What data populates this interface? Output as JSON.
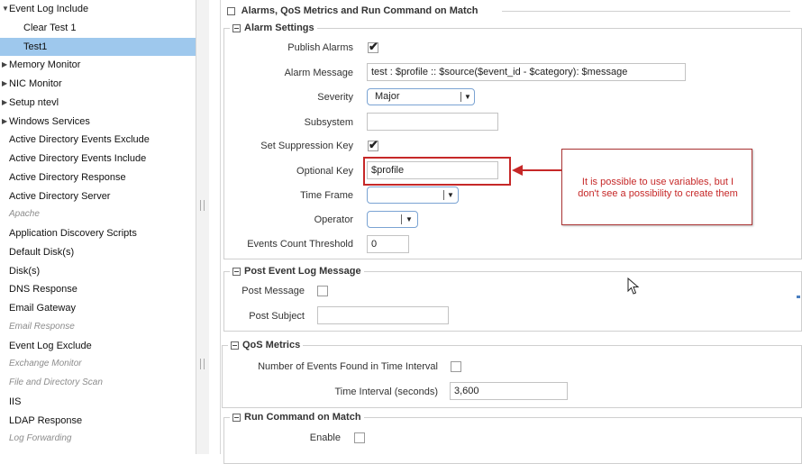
{
  "tree": {
    "items": [
      {
        "label": "Event Log Include",
        "arrow": "▼",
        "type": "expanded"
      },
      {
        "label": "Clear Test 1",
        "type": "child"
      },
      {
        "label": "Test1",
        "type": "child-selected"
      },
      {
        "label": "Memory Monitor",
        "arrow": "▶",
        "type": "collapsed"
      },
      {
        "label": "NIC Monitor",
        "arrow": "▶",
        "type": "collapsed"
      },
      {
        "label": "Setup ntevl",
        "arrow": "▶",
        "type": "collapsed"
      },
      {
        "label": "Windows Services",
        "arrow": "▶",
        "type": "collapsed"
      },
      {
        "label": "Active Directory Events Exclude",
        "type": "leaf"
      },
      {
        "label": "Active Directory Events Include",
        "type": "leaf"
      },
      {
        "label": "Active Directory Response",
        "type": "leaf"
      },
      {
        "label": "Active Directory Server",
        "type": "leaf"
      },
      {
        "label": "Apache",
        "type": "disabled"
      },
      {
        "label": "Application Discovery Scripts",
        "type": "leaf"
      },
      {
        "label": "Default Disk(s)",
        "type": "leaf"
      },
      {
        "label": "Disk(s)",
        "type": "leaf"
      },
      {
        "label": "DNS Response",
        "type": "leaf"
      },
      {
        "label": "Email Gateway",
        "type": "leaf"
      },
      {
        "label": "Email Response",
        "type": "disabled"
      },
      {
        "label": "Event Log Exclude",
        "type": "leaf"
      },
      {
        "label": "Exchange Monitor",
        "type": "disabled"
      },
      {
        "label": "File and Directory Scan",
        "type": "disabled"
      },
      {
        "label": "IIS",
        "type": "leaf"
      },
      {
        "label": "LDAP Response",
        "type": "leaf"
      },
      {
        "label": "Log Forwarding",
        "type": "disabled"
      }
    ]
  },
  "main": {
    "section_title": "Alarms, QoS Metrics and Run Command on Match",
    "alarm_settings": {
      "title": "Alarm Settings",
      "publish_alarms_label": "Publish Alarms",
      "publish_alarms_checked": true,
      "alarm_message_label": "Alarm Message",
      "alarm_message_value": "test :  $profile :: $source($event_id - $category): $message",
      "severity_label": "Severity",
      "severity_value": "Major",
      "subsystem_label": "Subsystem",
      "subsystem_value": "",
      "suppression_label": "Set Suppression Key",
      "suppression_checked": true,
      "optional_key_label": "Optional Key",
      "optional_key_value": "$profile",
      "time_frame_label": "Time Frame",
      "time_frame_value": "",
      "operator_label": "Operator",
      "operator_value": "",
      "events_threshold_label": "Events Count Threshold",
      "events_threshold_value": "0"
    },
    "post_event": {
      "title": "Post Event Log Message",
      "post_message_label": "Post Message",
      "post_message_checked": false,
      "post_subject_label": "Post Subject",
      "post_subject_value": ""
    },
    "qos": {
      "title": "QoS Metrics",
      "events_found_label": "Number of Events Found in Time Interval",
      "events_found_checked": false,
      "time_interval_label": "Time Interval (seconds)",
      "time_interval_value": "3,600"
    },
    "run_command": {
      "title": "Run Command on Match",
      "enable_label": "Enable",
      "enable_checked": false
    }
  },
  "annotation": {
    "text": "It is possible to use variables, but I don't see a possibility to create them",
    "color": "#c62828"
  },
  "colors": {
    "selected_bg": "#9ec8ed",
    "select_border": "#7aa3d3"
  }
}
